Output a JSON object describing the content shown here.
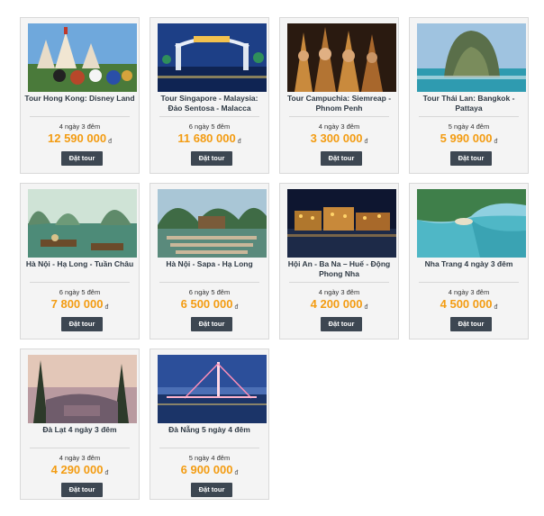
{
  "currency": "đ",
  "book_label": "Đặt tour",
  "tours": [
    {
      "title": "Tour Hong Kong: Disney Land",
      "duration": "4 ngày 3 đêm",
      "price": "12 590 000"
    },
    {
      "title": "Tour Singapore - Malaysia: Đảo Sentosa - Malacca",
      "duration": "6 ngày 5 đêm",
      "price": "11 680 000"
    },
    {
      "title": "Tour Campuchia: Siemreap - Phnom Penh",
      "duration": "4 ngày 3 đêm",
      "price": "3 300 000"
    },
    {
      "title": "Tour Thái Lan: Bangkok - Pattaya",
      "duration": "5 ngày 4 đêm",
      "price": "5 990 000"
    },
    {
      "title": "Hà Nội - Hạ Long - Tuần Châu",
      "duration": "6 ngày 5 đêm",
      "price": "7 800 000"
    },
    {
      "title": "Hà Nội - Sapa - Hạ Long",
      "duration": "6 ngày 5 đêm",
      "price": "6 500 000"
    },
    {
      "title": "Hội An - Ba Na – Huế - Động Phong Nha",
      "duration": "4 ngày 3 đêm",
      "price": "4 200 000"
    },
    {
      "title": "Nha Trang 4 ngày 3 đêm",
      "duration": "4 ngày 3 đêm",
      "price": "4 500 000"
    },
    {
      "title": "Đà Lạt 4 ngày 3 đêm",
      "duration": "4 ngày 3 đêm",
      "price": "4 290 000"
    },
    {
      "title": "Đà Nẵng 5 ngày 4 đêm",
      "duration": "5 ngày 4 đêm",
      "price": "6 900 000"
    }
  ]
}
